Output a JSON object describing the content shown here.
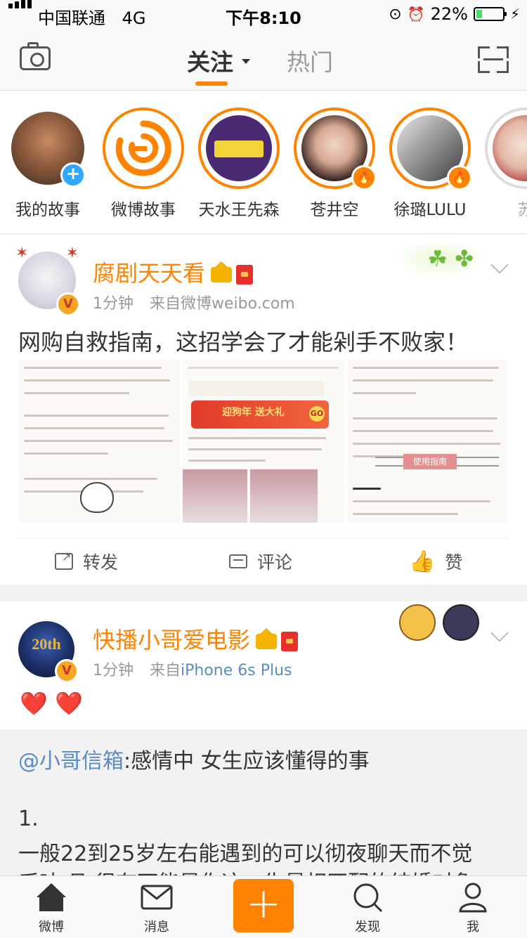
{
  "status_bar": {
    "carrier": "中国联通",
    "network": "4G",
    "time": "下午8:10",
    "battery_percent": "22%",
    "battery_level": 0.22
  },
  "nav": {
    "tab_following": "关注",
    "tab_hot": "热门"
  },
  "stories": [
    {
      "label": "我的故事",
      "badge": "plus"
    },
    {
      "label": "微博故事"
    },
    {
      "label": "天水王先森"
    },
    {
      "label": "苍井空",
      "badge": "fire"
    },
    {
      "label": "徐璐LULU",
      "badge": "fire"
    },
    {
      "label": "苏"
    }
  ],
  "post1": {
    "username": "腐剧天天看",
    "time": "1分钟",
    "source_prefix": "来自",
    "source": "微博weibo.com",
    "text": "网购自救指南，这招学会了才能剁手不败家！",
    "thumb2_banner": "迎狗年 送大礼",
    "thumb2_go": "GO",
    "thumb3_button": "使用指南",
    "actions": {
      "repost": "转发",
      "comment": "评论",
      "like": "赞"
    }
  },
  "post2": {
    "username": "快播小哥爱电影",
    "time": "1分钟",
    "source_prefix": "来自",
    "source": "iPhone 6s Plus",
    "avatar_text": "20th",
    "text": "❤️ ❤️"
  },
  "retweet": {
    "mention": "@小哥信箱",
    "text_after": ":感情中 女生应该懂得的事",
    "line2": "1.",
    "line3": "一般22到25岁左右能遇到的可以彻夜聊天而不觉",
    "line4": "乏味 且 很有可能是你这一生最相匹配的结婚对象"
  },
  "tabbar": {
    "home": "微博",
    "messages": "消息",
    "discover": "发现",
    "me": "我"
  },
  "colors": {
    "accent": "#ff8200",
    "link": "#5a8cc4",
    "text": "#333333",
    "muted": "#999999"
  }
}
